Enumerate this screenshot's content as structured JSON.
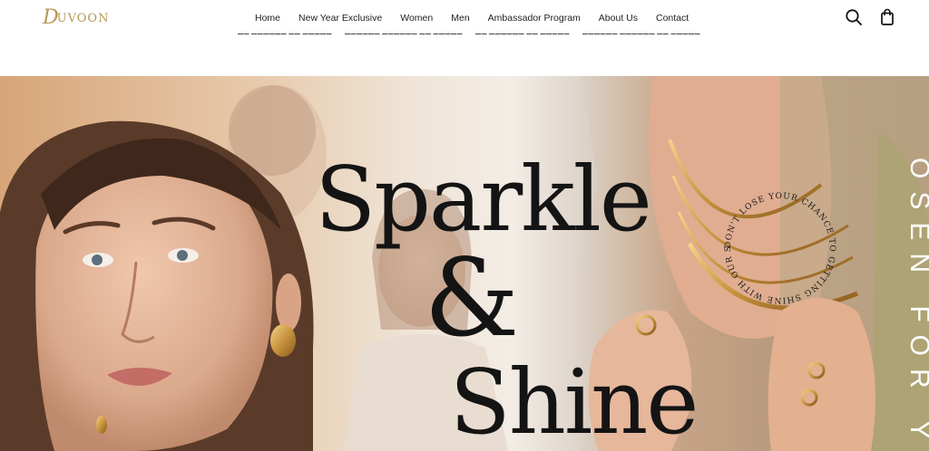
{
  "brand": {
    "logo_text": "DUVOON",
    "logo_initial": "D",
    "logo_rest": "UVOON"
  },
  "nav": {
    "items": [
      {
        "label": "Home"
      },
      {
        "label": "New Year Exclusive"
      },
      {
        "label": "Women"
      },
      {
        "label": "Men"
      },
      {
        "label": "Ambassador Program"
      },
      {
        "label": "About Us"
      },
      {
        "label": "Contact"
      }
    ]
  },
  "header_icons": {
    "search": "search-icon",
    "cart": "shopping-bag-icon"
  },
  "hero": {
    "line1": "Sparkle",
    "line2": "&",
    "line3": "Shine",
    "vertical_text": "OSEN FOR YOU",
    "circular_text": "DON'T LOSE YOUR CHANCE TO GETTING SHINE WITH OUR SHINY COLLECTI"
  },
  "colors": {
    "brand_gold": "#b89656",
    "text": "#222222",
    "headline": "#141414"
  }
}
